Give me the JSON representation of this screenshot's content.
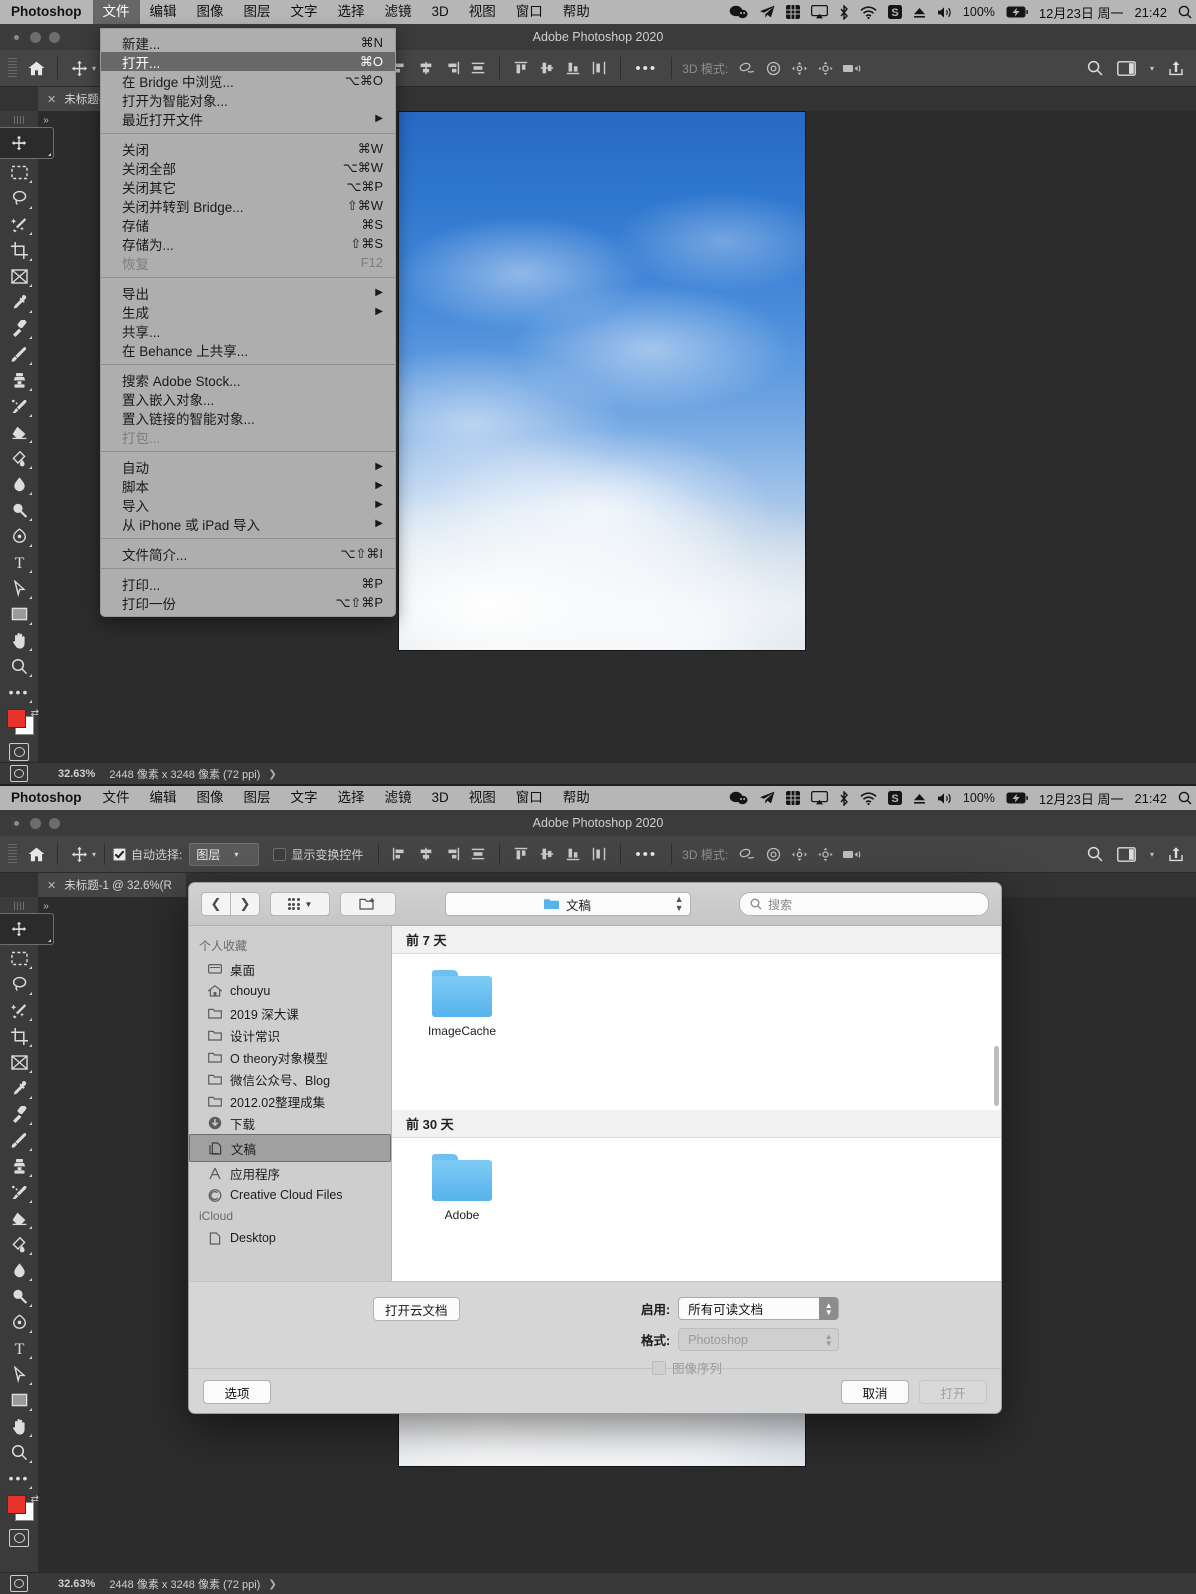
{
  "menubar": {
    "app": "Photoshop",
    "items": [
      "文件",
      "编辑",
      "图像",
      "图层",
      "文字",
      "选择",
      "滤镜",
      "3D",
      "视图",
      "窗口",
      "帮助"
    ],
    "active_item": "文件",
    "status_icons": [
      "wechat-icon",
      "telegram-icon",
      "grid-icon",
      "airplay-icon",
      "bluetooth-icon",
      "wifi-icon",
      "sogou-input-icon",
      "eject-icon",
      "volume-icon"
    ],
    "battery_percent": "100%",
    "battery_icon": "battery-charging-icon",
    "date": "12月23日 周一",
    "time": "21:42",
    "spotlight_icon": "spotlight-search-icon"
  },
  "window": {
    "title": "Adobe Photoshop 2020",
    "tab": {
      "close_icon": "close-icon",
      "label": "未标题-1 @ 32.6%(R"
    },
    "status": {
      "zoom": "32.63%",
      "dimensions": "2448 像素 x 3248 像素 (72 ppi)",
      "arrow": "❯"
    }
  },
  "options_bar": {
    "home_icon": "home-icon",
    "move_tool_icon": "move-tool-icon",
    "auto_select_label": "自动选择:",
    "auto_select_checked": true,
    "auto_select_value": "图层",
    "show_transform_label": "显示变换控件",
    "show_transform_checked": false,
    "align_icons": [
      "align-left-icon",
      "align-center-horizontal-icon",
      "align-right-icon",
      "distribute-horizontal-icon",
      "align-top-icon",
      "align-center-vertical-icon",
      "align-bottom-icon",
      "distribute-vertical-icon"
    ],
    "more_icon": "ellipsis-icon",
    "mode3d_label": "3D 模式:",
    "mode3d_icons": [
      "orbit-3d-icon",
      "roll-3d-icon",
      "pan-3d-icon",
      "slide-3d-icon",
      "zoom-3d-camera-icon"
    ],
    "search_icon": "search-icon",
    "workspace_icon": "workspace-icon",
    "workspace_caret_icon": "chevron-down-icon",
    "share_icon": "share-icon"
  },
  "toolbar": {
    "tools": [
      {
        "name": "move-tool-icon",
        "selected": true
      },
      {
        "name": "marquee-tool-icon",
        "selected": false
      },
      {
        "name": "lasso-tool-icon",
        "selected": false
      },
      {
        "name": "magic-wand-tool-icon",
        "selected": false
      },
      {
        "name": "crop-tool-icon",
        "selected": false
      },
      {
        "name": "frame-tool-icon",
        "selected": false
      },
      {
        "name": "eyedropper-tool-icon",
        "selected": false
      },
      {
        "name": "healing-brush-tool-icon",
        "selected": false
      },
      {
        "name": "brush-tool-icon",
        "selected": false
      },
      {
        "name": "clone-stamp-tool-icon",
        "selected": false
      },
      {
        "name": "history-brush-tool-icon",
        "selected": false
      },
      {
        "name": "eraser-tool-icon",
        "selected": false
      },
      {
        "name": "gradient-tool-icon",
        "selected": false
      },
      {
        "name": "blur-tool-icon",
        "selected": false
      },
      {
        "name": "dodge-tool-icon",
        "selected": false
      },
      {
        "name": "pen-tool-icon",
        "selected": false
      },
      {
        "name": "type-tool-icon",
        "selected": false
      },
      {
        "name": "path-selection-tool-icon",
        "selected": false
      },
      {
        "name": "rectangle-tool-icon",
        "selected": false
      },
      {
        "name": "hand-tool-icon",
        "selected": false
      },
      {
        "name": "zoom-tool-icon",
        "selected": false
      },
      {
        "name": "edit-toolbar-icon",
        "selected": false
      }
    ],
    "foreground_color": "#e8322c",
    "background_color": "#ffffff",
    "quick_mask_icon": "quick-mask-icon"
  },
  "file_menu": {
    "groups": [
      [
        {
          "label": "新建...",
          "shortcut": "⌘N",
          "highlighted": false,
          "disabled": false,
          "submenu": false
        },
        {
          "label": "打开...",
          "shortcut": "⌘O",
          "highlighted": true,
          "disabled": false,
          "submenu": false
        },
        {
          "label": "在 Bridge 中浏览...",
          "shortcut": "⌥⌘O",
          "highlighted": false,
          "disabled": false,
          "submenu": false
        },
        {
          "label": "打开为智能对象...",
          "shortcut": "",
          "highlighted": false,
          "disabled": false,
          "submenu": false
        },
        {
          "label": "最近打开文件",
          "shortcut": "",
          "highlighted": false,
          "disabled": false,
          "submenu": true
        }
      ],
      [
        {
          "label": "关闭",
          "shortcut": "⌘W",
          "highlighted": false,
          "disabled": false,
          "submenu": false
        },
        {
          "label": "关闭全部",
          "shortcut": "⌥⌘W",
          "highlighted": false,
          "disabled": false,
          "submenu": false
        },
        {
          "label": "关闭其它",
          "shortcut": "⌥⌘P",
          "highlighted": false,
          "disabled": false,
          "submenu": false
        },
        {
          "label": "关闭并转到 Bridge...",
          "shortcut": "⇧⌘W",
          "highlighted": false,
          "disabled": false,
          "submenu": false
        },
        {
          "label": "存储",
          "shortcut": "⌘S",
          "highlighted": false,
          "disabled": false,
          "submenu": false
        },
        {
          "label": "存储为...",
          "shortcut": "⇧⌘S",
          "highlighted": false,
          "disabled": false,
          "submenu": false
        },
        {
          "label": "恢复",
          "shortcut": "F12",
          "highlighted": false,
          "disabled": true,
          "submenu": false
        }
      ],
      [
        {
          "label": "导出",
          "shortcut": "",
          "highlighted": false,
          "disabled": false,
          "submenu": true
        },
        {
          "label": "生成",
          "shortcut": "",
          "highlighted": false,
          "disabled": false,
          "submenu": true
        },
        {
          "label": "共享...",
          "shortcut": "",
          "highlighted": false,
          "disabled": false,
          "submenu": false
        },
        {
          "label": "在 Behance 上共享...",
          "shortcut": "",
          "highlighted": false,
          "disabled": false,
          "submenu": false
        }
      ],
      [
        {
          "label": "搜索 Adobe Stock...",
          "shortcut": "",
          "highlighted": false,
          "disabled": false,
          "submenu": false
        },
        {
          "label": "置入嵌入对象...",
          "shortcut": "",
          "highlighted": false,
          "disabled": false,
          "submenu": false
        },
        {
          "label": "置入链接的智能对象...",
          "shortcut": "",
          "highlighted": false,
          "disabled": false,
          "submenu": false
        },
        {
          "label": "打包...",
          "shortcut": "",
          "highlighted": false,
          "disabled": true,
          "submenu": false
        }
      ],
      [
        {
          "label": "自动",
          "shortcut": "",
          "highlighted": false,
          "disabled": false,
          "submenu": true
        },
        {
          "label": "脚本",
          "shortcut": "",
          "highlighted": false,
          "disabled": false,
          "submenu": true
        },
        {
          "label": "导入",
          "shortcut": "",
          "highlighted": false,
          "disabled": false,
          "submenu": true
        },
        {
          "label": "从 iPhone 或 iPad 导入",
          "shortcut": "",
          "highlighted": false,
          "disabled": false,
          "submenu": true
        }
      ],
      [
        {
          "label": "文件简介...",
          "shortcut": "⌥⇧⌘I",
          "highlighted": false,
          "disabled": false,
          "submenu": false
        }
      ],
      [
        {
          "label": "打印...",
          "shortcut": "⌘P",
          "highlighted": false,
          "disabled": false,
          "submenu": false
        },
        {
          "label": "打印一份",
          "shortcut": "⌥⇧⌘P",
          "highlighted": false,
          "disabled": false,
          "submenu": false
        }
      ]
    ]
  },
  "open_dialog": {
    "toolbar": {
      "back_icon": "chevron-left-icon",
      "forward_icon": "chevron-right-icon",
      "view_icon": "view-options-icon",
      "view_caret_icon": "chevron-down-icon",
      "new_folder_icon": "new-folder-icon",
      "path_folder_icon": "folder-icon",
      "path_label": "文稿",
      "path_caret_icon": "up-down-chevron-icon",
      "search_icon": "search-icon",
      "search_placeholder": "搜索"
    },
    "sidebar": [
      {
        "section": "个人收藏",
        "items": [
          {
            "label": "桌面",
            "icon": "desktop-icon",
            "selected": false
          },
          {
            "label": "chouyu",
            "icon": "home-icon",
            "selected": false
          },
          {
            "label": "2019 深大课",
            "icon": "folder-icon",
            "selected": false
          },
          {
            "label": "设计常识",
            "icon": "folder-icon",
            "selected": false
          },
          {
            "label": "O theory对象模型",
            "icon": "folder-icon",
            "selected": false
          },
          {
            "label": "微信公众号、Blog",
            "icon": "folder-icon",
            "selected": false
          },
          {
            "label": "2012.02整理成集",
            "icon": "folder-icon",
            "selected": false
          },
          {
            "label": "下载",
            "icon": "downloads-icon",
            "selected": false
          },
          {
            "label": "文稿",
            "icon": "documents-icon",
            "selected": true
          },
          {
            "label": "应用程序",
            "icon": "applications-icon",
            "selected": false
          },
          {
            "label": "Creative Cloud Files",
            "icon": "creative-cloud-icon",
            "selected": false
          }
        ]
      },
      {
        "section": "iCloud",
        "items": [
          {
            "label": "Desktop",
            "icon": "file-icon",
            "selected": false
          }
        ]
      }
    ],
    "groups": [
      {
        "title": "前 7 天",
        "files": [
          {
            "name": "ImageCache",
            "icon": "folder-icon"
          }
        ]
      },
      {
        "title": "前 30 天",
        "files": [
          {
            "name": "Adobe",
            "icon": "folder-icon"
          }
        ]
      }
    ],
    "cloud_button": "打开云文档",
    "enable_label": "启用:",
    "enable_value": "所有可读文档",
    "format_label": "格式:",
    "format_value": "Photoshop",
    "image_sequence_label": "图像序列",
    "image_sequence_checked": false,
    "options_button": "选项",
    "cancel_button": "取消",
    "open_button": "打开"
  }
}
